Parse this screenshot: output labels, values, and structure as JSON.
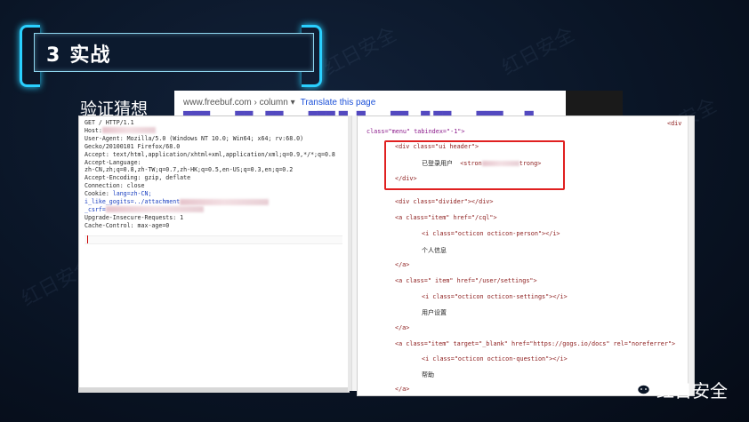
{
  "slide": {
    "number": "3",
    "title": "实战",
    "subtitle": "验证猜想",
    "brand": "红日安全",
    "brand_icon": "wechat-icon"
  },
  "search_result": {
    "url": "www.freebuf.com › column ▾",
    "translate": "Translate this page"
  },
  "request": {
    "lines": {
      "l1": "GET / HTTP/1.1",
      "l2": "Host:",
      "l3": "User-Agent: Mozilla/5.0 (Windows NT 10.0; Win64; x64; rv:68.0)",
      "l4": "Gecko/20100101 Firefox/68.0",
      "l5": "Accept: text/html,application/xhtml+xml,application/xml;q=0.9,*/*;q=0.8",
      "l6": "Accept-Language:",
      "l7": "zh-CN,zh;q=0.8,zh-TW;q=0.7,zh-HK;q=0.5,en-US;q=0.3,en;q=0.2",
      "l8": "Accept-Encoding: gzip, deflate",
      "l9": "Connection: close",
      "l10a": "Cookie: ",
      "l10b": "lang=zh-CN;",
      "l11": "i_like_gogits=../attachment",
      "l12": "_csrf=",
      "l13": "Upgrade-Insecure-Requests: 1",
      "l14": "Cache-Control: max-age=0"
    }
  },
  "source": {
    "top_right": "<div",
    "menu_line": "class=\"menu\" tabindex=\"-1\">",
    "header_open": "<div class=\"ui header\">",
    "logged_in": "已登录用户",
    "strong_open": "<stron",
    "strong_close": "trong>",
    "div_close": "</div>",
    "divider": "<div class=\"divider\"></div>",
    "a_cql": "<a class=\"item\" href=\"/cql\">",
    "i_person": "<i class=\"octicon octicon-person\"></i>",
    "profile": "个人信息",
    "a_close": "</a>",
    "a_settings": "<a class=\" item\" href=\"/user/settings\">",
    "i_settings": "<i class=\"octicon octicon-settings\"></i>",
    "user_settings": "用户设置",
    "a_help": "<a class=\"item\" target=\"_blank\" href=\"https://gogs.io/docs\" rel=\"noreferrer\">",
    "i_question": "<i class=\"octicon octicon-question\"></i>",
    "help": "帮助"
  }
}
